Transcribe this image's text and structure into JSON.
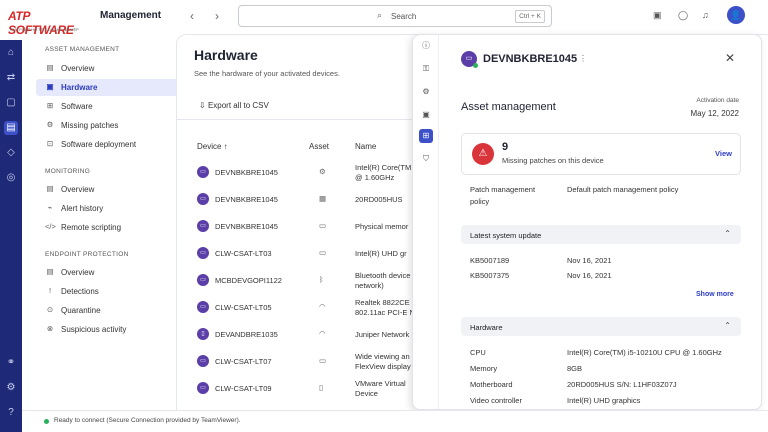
{
  "logo": {
    "brand": "ATP SOFTWARE",
    "tagline": "GIẢI PHÁP HỖ TRỢ DOANH NGHIỆP"
  },
  "header": {
    "title": "Management",
    "search_placeholder": "Search",
    "shortcut": "Ctrl + K",
    "avatar_initial": "👤"
  },
  "sidebar": {
    "sections": [
      {
        "title": "ASSET MANAGEMENT",
        "items": [
          {
            "label": "Overview",
            "icon": "▤"
          },
          {
            "label": "Hardware",
            "icon": "▣"
          },
          {
            "label": "Software",
            "icon": "⊞"
          },
          {
            "label": "Missing patches",
            "icon": "⚙"
          },
          {
            "label": "Software deployment",
            "icon": "⊡"
          }
        ]
      },
      {
        "title": "MONITORING",
        "items": [
          {
            "label": "Overview",
            "icon": "▤"
          },
          {
            "label": "Alert history",
            "icon": "⌁"
          },
          {
            "label": "Remote scripting",
            "icon": "</>"
          }
        ]
      },
      {
        "title": "ENDPOINT PROTECTION",
        "items": [
          {
            "label": "Overview",
            "icon": "▤"
          },
          {
            "label": "Detections",
            "icon": "!"
          },
          {
            "label": "Quarantine",
            "icon": "⊙"
          },
          {
            "label": "Suspicious activity",
            "icon": "⊗"
          }
        ]
      }
    ]
  },
  "main": {
    "title": "Hardware",
    "subtitle": "See the hardware of your activated devices.",
    "export_label": "Export all to CSV",
    "columns": {
      "device": "Device ↑",
      "asset": "Asset",
      "name": "Name"
    },
    "rows": [
      {
        "device": "DEVNBKBRE1045",
        "name1": "Intel(R) Core(TM",
        "name2": "@ 1.60GHz",
        "asset_icon": "⚙"
      },
      {
        "device": "DEVNBKBRE1045",
        "name1": "20RD005HUS",
        "name2": "",
        "asset_icon": "▦"
      },
      {
        "device": "DEVNBKBRE1045",
        "name1": "Physical memor",
        "name2": "",
        "asset_icon": "▭"
      },
      {
        "device": "CLW-CSAT-LT03",
        "name1": "Intel(R) UHD gr",
        "name2": "",
        "asset_icon": "▭"
      },
      {
        "device": "MCBDEVGOPI1122",
        "name1": "Bluetooth device",
        "name2": "network)",
        "asset_icon": "ᛒ"
      },
      {
        "device": "CLW-CSAT-LT05",
        "name1": "Realtek 8822CE",
        "name2": "802.11ac PCI-E N",
        "asset_icon": "◠"
      },
      {
        "device": "DEVANDBRE1035",
        "name1": "Juniper Network",
        "name2": "",
        "asset_icon": "◠"
      },
      {
        "device": "CLW-CSAT-LT07",
        "name1": "Wide viewing an",
        "name2": "FlexView display",
        "asset_icon": "▭"
      },
      {
        "device": "CLW-CSAT-LT09",
        "name1": "VMware Virtual",
        "name2": "Device",
        "asset_icon": "▯"
      }
    ]
  },
  "panel": {
    "device": "DEVNBKBRE1045",
    "heading": "Asset management",
    "activation_label": "Activation date",
    "activation_value": "May 12, 2022",
    "missing_count": "9",
    "missing_text": "Missing patches on this device",
    "view_label": "View",
    "policy_label1": "Patch management",
    "policy_label2": "policy",
    "policy_value": "Default patch management policy",
    "updates_title": "Latest system update",
    "updates": [
      {
        "kb": "KB5007189",
        "date": "Nov 16, 2021"
      },
      {
        "kb": "KB5007375",
        "date": "Nov 16, 2021"
      }
    ],
    "show_more": "Show more",
    "hardware_title": "Hardware",
    "hardware": [
      {
        "k": "CPU",
        "v": "Intel(R) Core(TM) i5-10210U CPU @ 1.60GHz"
      },
      {
        "k": "Memory",
        "v": "8GB"
      },
      {
        "k": "Motherboard",
        "v": "20RD005HUS S/N: L1HF03Z07J"
      },
      {
        "k": "Video controller",
        "v": "Intel(R) UHD graphics"
      }
    ]
  },
  "status": {
    "text": "Ready to connect (Secure Connection provided by TeamViewer)."
  }
}
